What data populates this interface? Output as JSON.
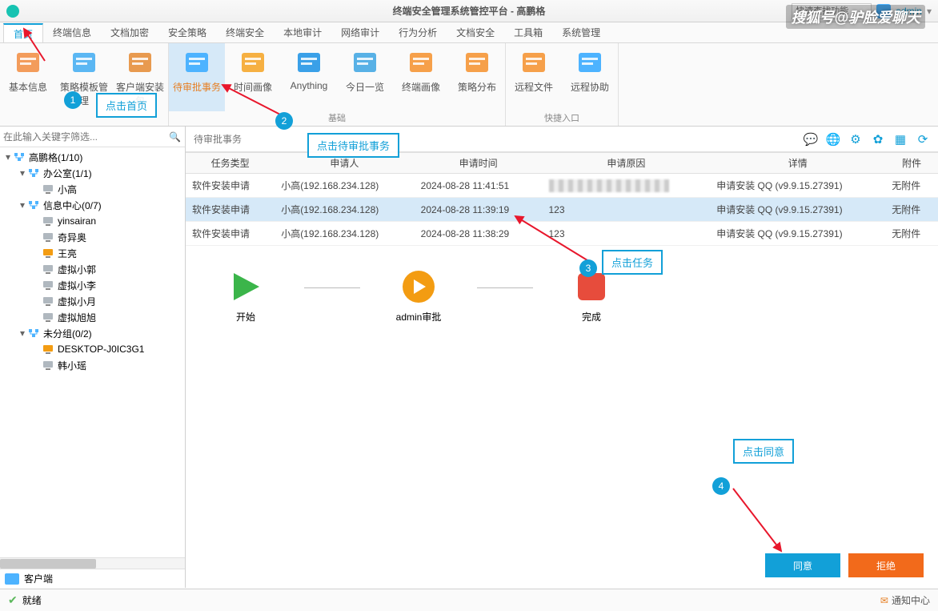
{
  "window": {
    "title": "终端安全管理系统管控平台 - 高鹏格",
    "search_placeholder": "快速查找功能",
    "user": "admin"
  },
  "watermark": "搜狐号@驴脸爱聊天",
  "menu": [
    "首页",
    "终端信息",
    "文档加密",
    "安全策略",
    "终端安全",
    "本地审计",
    "网络审计",
    "行为分析",
    "文档安全",
    "工具箱",
    "系统管理"
  ],
  "ribbon": {
    "groups": [
      {
        "label": "",
        "items": [
          {
            "label": "基本信息",
            "icon": "#f39c5b"
          },
          {
            "label": "策略模板管理",
            "icon": "#5bb7f3"
          },
          {
            "label": "客户端安装包",
            "icon": "#e89a4f"
          }
        ]
      },
      {
        "label": "基础",
        "items": [
          {
            "label": "待审批事务",
            "icon": "#4db3ff",
            "highlight": true
          },
          {
            "label": "时间画像",
            "icon": "#f6b042"
          },
          {
            "label": "Anything",
            "icon": "#3aa0e8"
          },
          {
            "label": "今日一览",
            "icon": "#58b1e6"
          },
          {
            "label": "终端画像",
            "icon": "#f6a04a"
          },
          {
            "label": "策略分布",
            "icon": "#f6a04a"
          }
        ]
      },
      {
        "label": "快捷入口",
        "items": [
          {
            "label": "远程文件",
            "icon": "#f6a04a"
          },
          {
            "label": "远程协助",
            "icon": "#4db3ff"
          }
        ]
      }
    ]
  },
  "sidebar": {
    "search_placeholder": "在此输入关键字筛选...",
    "footer": "客户端",
    "tree": [
      {
        "d": 0,
        "exp": "▾",
        "icon": "org",
        "label": "高鹏格(1/10)"
      },
      {
        "d": 1,
        "exp": "▾",
        "icon": "org",
        "label": "办公室(1/1)"
      },
      {
        "d": 2,
        "exp": "",
        "icon": "pc",
        "label": "小高"
      },
      {
        "d": 1,
        "exp": "▾",
        "icon": "org",
        "label": "信息中心(0/7)"
      },
      {
        "d": 2,
        "exp": "",
        "icon": "pc",
        "label": "yinsairan"
      },
      {
        "d": 2,
        "exp": "",
        "icon": "pc",
        "label": "奇异奥"
      },
      {
        "d": 2,
        "exp": "",
        "icon": "pc-orange",
        "label": "王亮"
      },
      {
        "d": 2,
        "exp": "",
        "icon": "pc",
        "label": "虚拟小郭"
      },
      {
        "d": 2,
        "exp": "",
        "icon": "pc",
        "label": "虚拟小李"
      },
      {
        "d": 2,
        "exp": "",
        "icon": "pc",
        "label": "虚拟小月"
      },
      {
        "d": 2,
        "exp": "",
        "icon": "pc",
        "label": "虚拟旭旭"
      },
      {
        "d": 1,
        "exp": "▾",
        "icon": "org",
        "label": "未分组(0/2)"
      },
      {
        "d": 2,
        "exp": "",
        "icon": "pc-orange",
        "label": "DESKTOP-J0IC3G1"
      },
      {
        "d": 2,
        "exp": "",
        "icon": "pc",
        "label": "韩小瑶"
      }
    ]
  },
  "main": {
    "title": "待审批事务",
    "columns": [
      "任务类型",
      "申请人",
      "申请时间",
      "申请原因",
      "详情",
      "附件"
    ],
    "rows": [
      {
        "type": "软件安装申请",
        "applicant": "小高(192.168.234.128)",
        "time": "2024-08-28 11:41:51",
        "reason": "",
        "detail": "申请安装 QQ (v9.9.15.27391)",
        "attach": "无附件",
        "censored": true
      },
      {
        "type": "软件安装申请",
        "applicant": "小高(192.168.234.128)",
        "time": "2024-08-28 11:39:19",
        "reason": "123",
        "detail": "申请安装 QQ (v9.9.15.27391)",
        "attach": "无附件",
        "selected": true
      },
      {
        "type": "软件安装申请",
        "applicant": "小高(192.168.234.128)",
        "time": "2024-08-28 11:38:29",
        "reason": "123",
        "detail": "申请安装 QQ (v9.9.15.27391)",
        "attach": "无附件"
      }
    ],
    "workflow": {
      "start": "开始",
      "approve": "admin审批",
      "done": "完成"
    },
    "btn_agree": "同意",
    "btn_reject": "拒绝"
  },
  "status": {
    "ready": "就绪",
    "notify": "通知中心"
  },
  "annotations": {
    "c1": "点击首页",
    "c2": "点击待审批事务",
    "c3": "点击任务",
    "c4": "点击同意",
    "b1": "1",
    "b2": "2",
    "b3": "3",
    "b4": "4"
  }
}
